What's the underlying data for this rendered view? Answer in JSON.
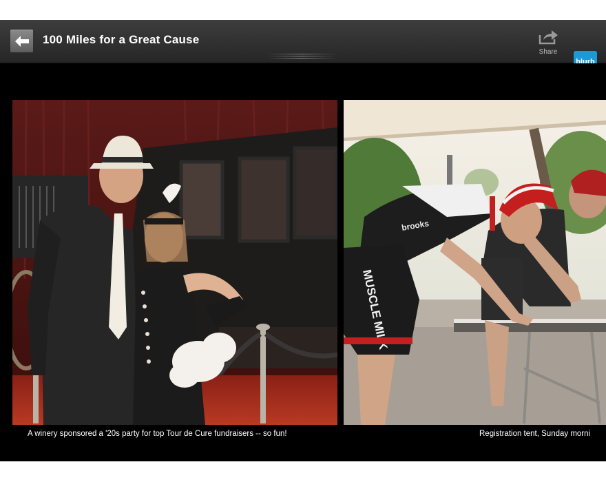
{
  "toolbar": {
    "title": "100 Miles for a Great Cause",
    "back_icon": "back-arrow-icon",
    "share_label": "Share",
    "share_icon": "share-icon",
    "logo_text": "blurb",
    "logo_color": "#1d9ad6"
  },
  "pages": [
    {
      "caption": "A winery sponsored a '20s party for top Tour de Cure fundraisers -- so fun!"
    },
    {
      "caption": "Registration tent, Sunday morni",
      "jersey_text": "MUSCLE MILK",
      "chest_text": "brooks"
    }
  ]
}
